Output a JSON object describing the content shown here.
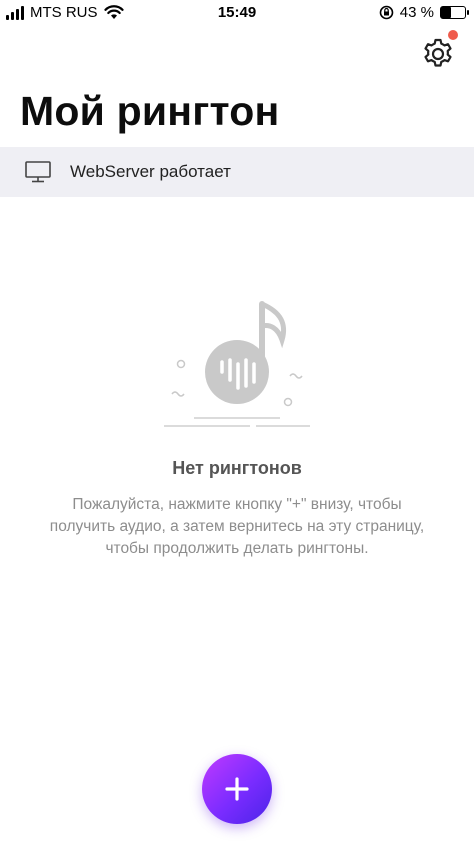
{
  "status_bar": {
    "carrier": "MTS RUS",
    "time": "15:49",
    "battery_percent_label": "43 %",
    "battery_level": 0.43
  },
  "header": {
    "title": "Мой рингтон"
  },
  "server_bar": {
    "label": "WebServer работает",
    "icon": "monitor-icon"
  },
  "empty_state": {
    "title": "Нет рингтонов",
    "message": "Пожалуйста, нажмите кнопку \"+\" внизу, чтобы получить аудио, а затем вернитесь на эту страницу, чтобы продолжить делать рингтоны.",
    "illustration": "music-note-illustration"
  },
  "fab": {
    "icon": "plus-icon",
    "gradient": [
      "#c03aff",
      "#4a24e8"
    ]
  },
  "colors": {
    "notification_dot": "#ef5b4c",
    "server_bar_bg": "#efeff4"
  }
}
